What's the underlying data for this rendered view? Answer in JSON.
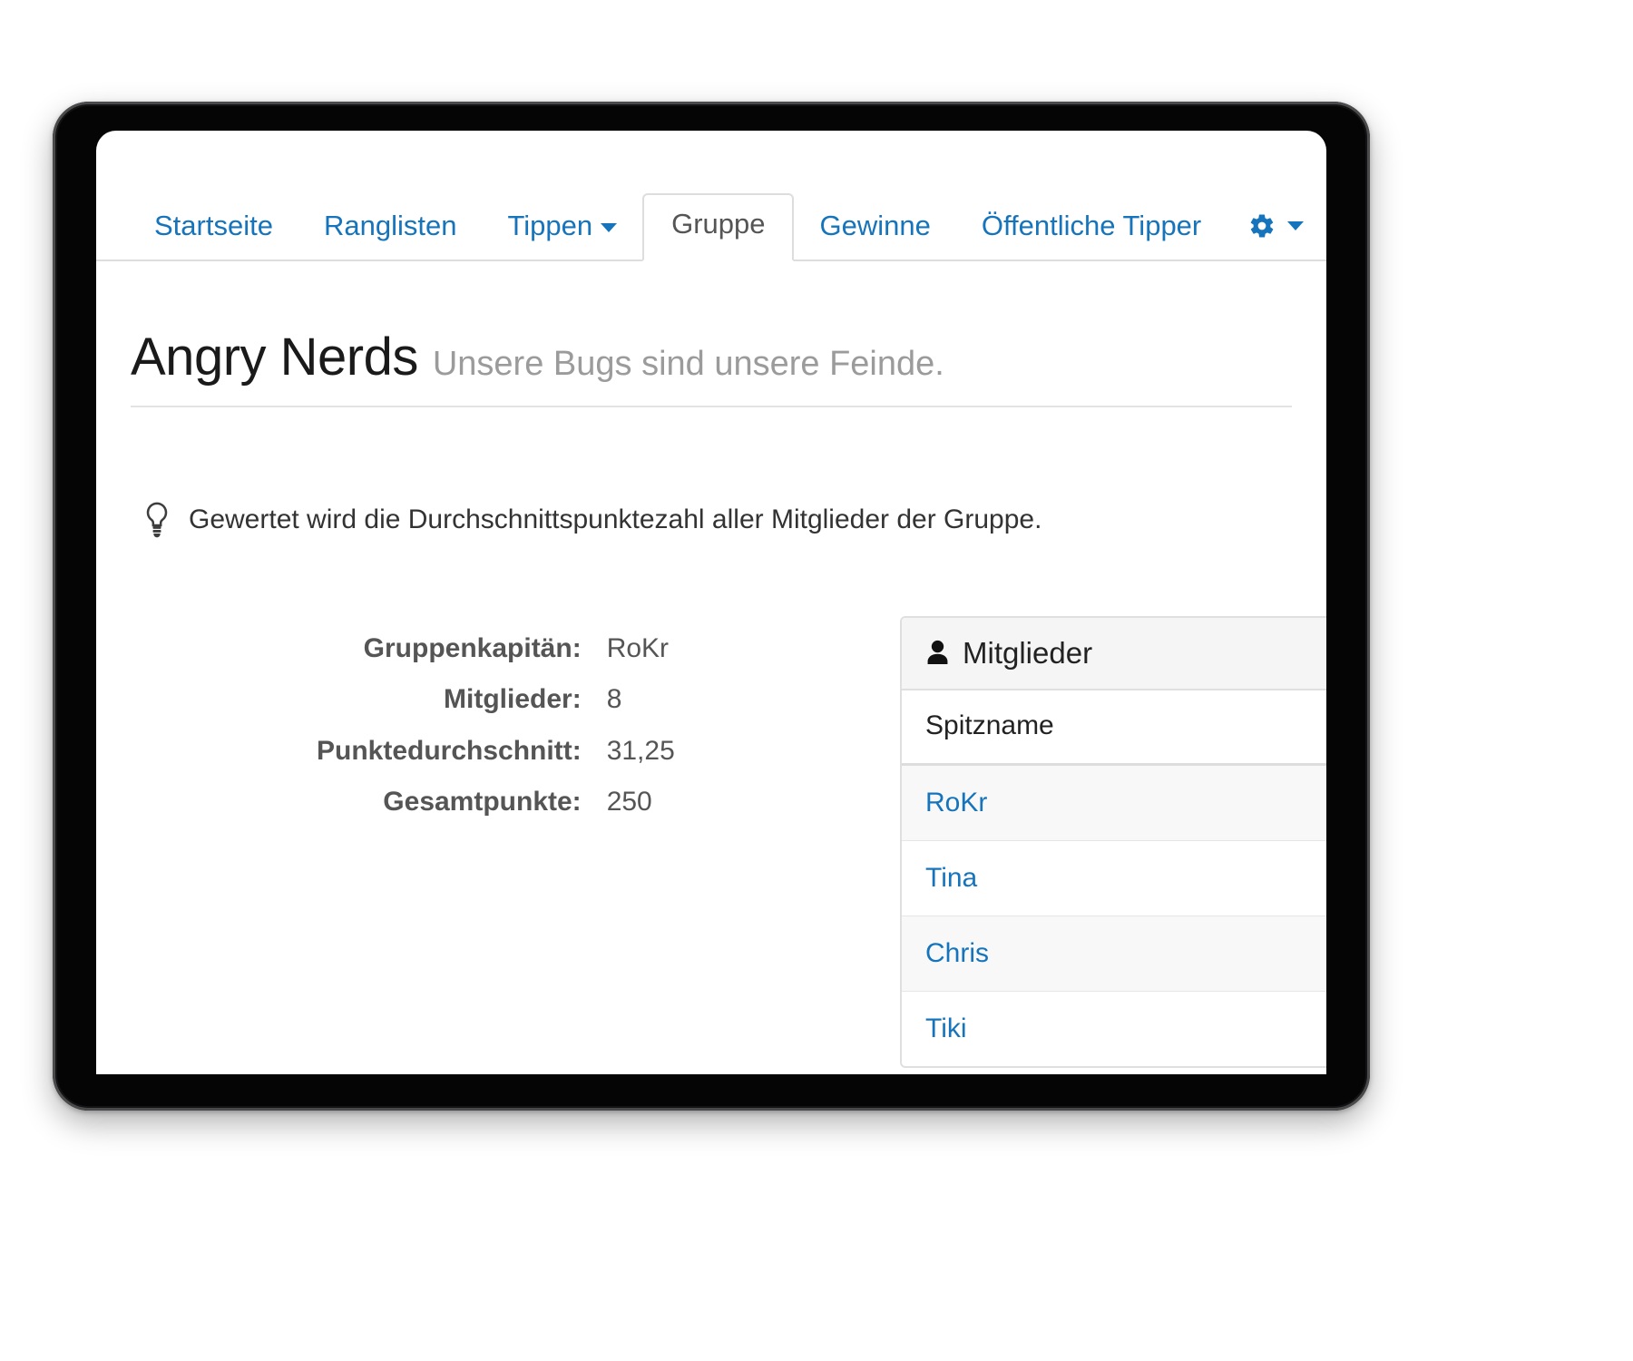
{
  "nav": {
    "items": [
      {
        "label": "Startseite",
        "active": false,
        "caret": false,
        "name": "nav-startseite"
      },
      {
        "label": "Ranglisten",
        "active": false,
        "caret": false,
        "name": "nav-ranglisten"
      },
      {
        "label": "Tippen",
        "active": false,
        "caret": true,
        "name": "nav-tippen"
      },
      {
        "label": "Gruppe",
        "active": true,
        "caret": false,
        "name": "nav-gruppe"
      },
      {
        "label": "Gewinne",
        "active": false,
        "caret": false,
        "name": "nav-gewinne"
      },
      {
        "label": "Öffentliche Tipper",
        "active": false,
        "caret": false,
        "name": "nav-oeffentliche-tipper"
      }
    ],
    "settings_icon": "gear-icon",
    "settings_caret": "chevron-down-icon"
  },
  "header": {
    "title": "Angry Nerds",
    "subtitle": "Unsere Bugs sind unsere Feinde."
  },
  "hint": {
    "icon": "lightbulb-icon",
    "text": "Gewertet wird die Durchschnittspunktezahl aller Mitglieder der Gruppe."
  },
  "stats": {
    "rows": [
      {
        "label": "Gruppenkapitän:",
        "value": "RoKr"
      },
      {
        "label": "Mitglieder:",
        "value": "8"
      },
      {
        "label": "Punktedurchschnitt:",
        "value": "31,25"
      },
      {
        "label": "Gesamtpunkte:",
        "value": "250"
      }
    ]
  },
  "members": {
    "panel_icon": "person-icon",
    "panel_title": "Mitglieder",
    "column_header": "Spitzname",
    "rows": [
      {
        "nickname": "RoKr"
      },
      {
        "nickname": "Tina"
      },
      {
        "nickname": "Chris"
      },
      {
        "nickname": "Tiki"
      }
    ]
  },
  "colors": {
    "link": "#1574bb",
    "text": "#333333",
    "muted": "#9b9b9b",
    "panel_bg": "#f5f5f5",
    "border": "#dddddd",
    "bezel": "#050505"
  }
}
